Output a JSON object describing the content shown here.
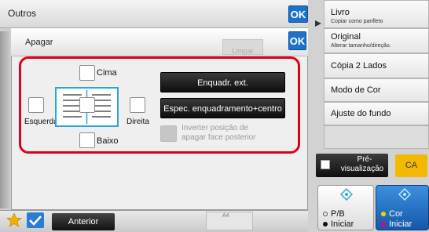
{
  "topbar": {
    "title": "Outros",
    "ok_label": "OK"
  },
  "dialog": {
    "title": "Apagar",
    "ok_label": "OK",
    "clear_label": "Limpar",
    "top_label": "Cima",
    "left_label": "Esquerda",
    "right_label": "Direita",
    "bottom_label": "Baixo",
    "outer_frame_label": "Enquadr. ext.",
    "frame_center_label": "Espec. enquadramento+centro",
    "invert_line1": "Inverter posição de",
    "invert_line2": "apagar face posterior"
  },
  "right_panel": {
    "book_title": "Livro",
    "book_sub": "Copiar como panfleto",
    "original_title": "Original",
    "original_sub": "Alterar tamanho/direção.",
    "duplex": "Cópia 2 Lados",
    "color_mode": "Modo de Cor",
    "background": "Ajuste do fundo",
    "preview_line1": "Pré-",
    "preview_line2": "visualização",
    "ca_label": "CA",
    "bw_line1": "P/B",
    "bw_line2": "Iniciar",
    "color_line1": "Cor",
    "color_line2": "Iniciar"
  },
  "bottombar": {
    "back_label": "Anterior",
    "paper_label": "A4"
  },
  "colors": {
    "accent_blue": "#1e73c8",
    "highlight_red": "#e1001a",
    "ca_yellow": "#f2b900",
    "doc_blue": "#2aa6d6",
    "start_blue": "#1e73c8"
  }
}
